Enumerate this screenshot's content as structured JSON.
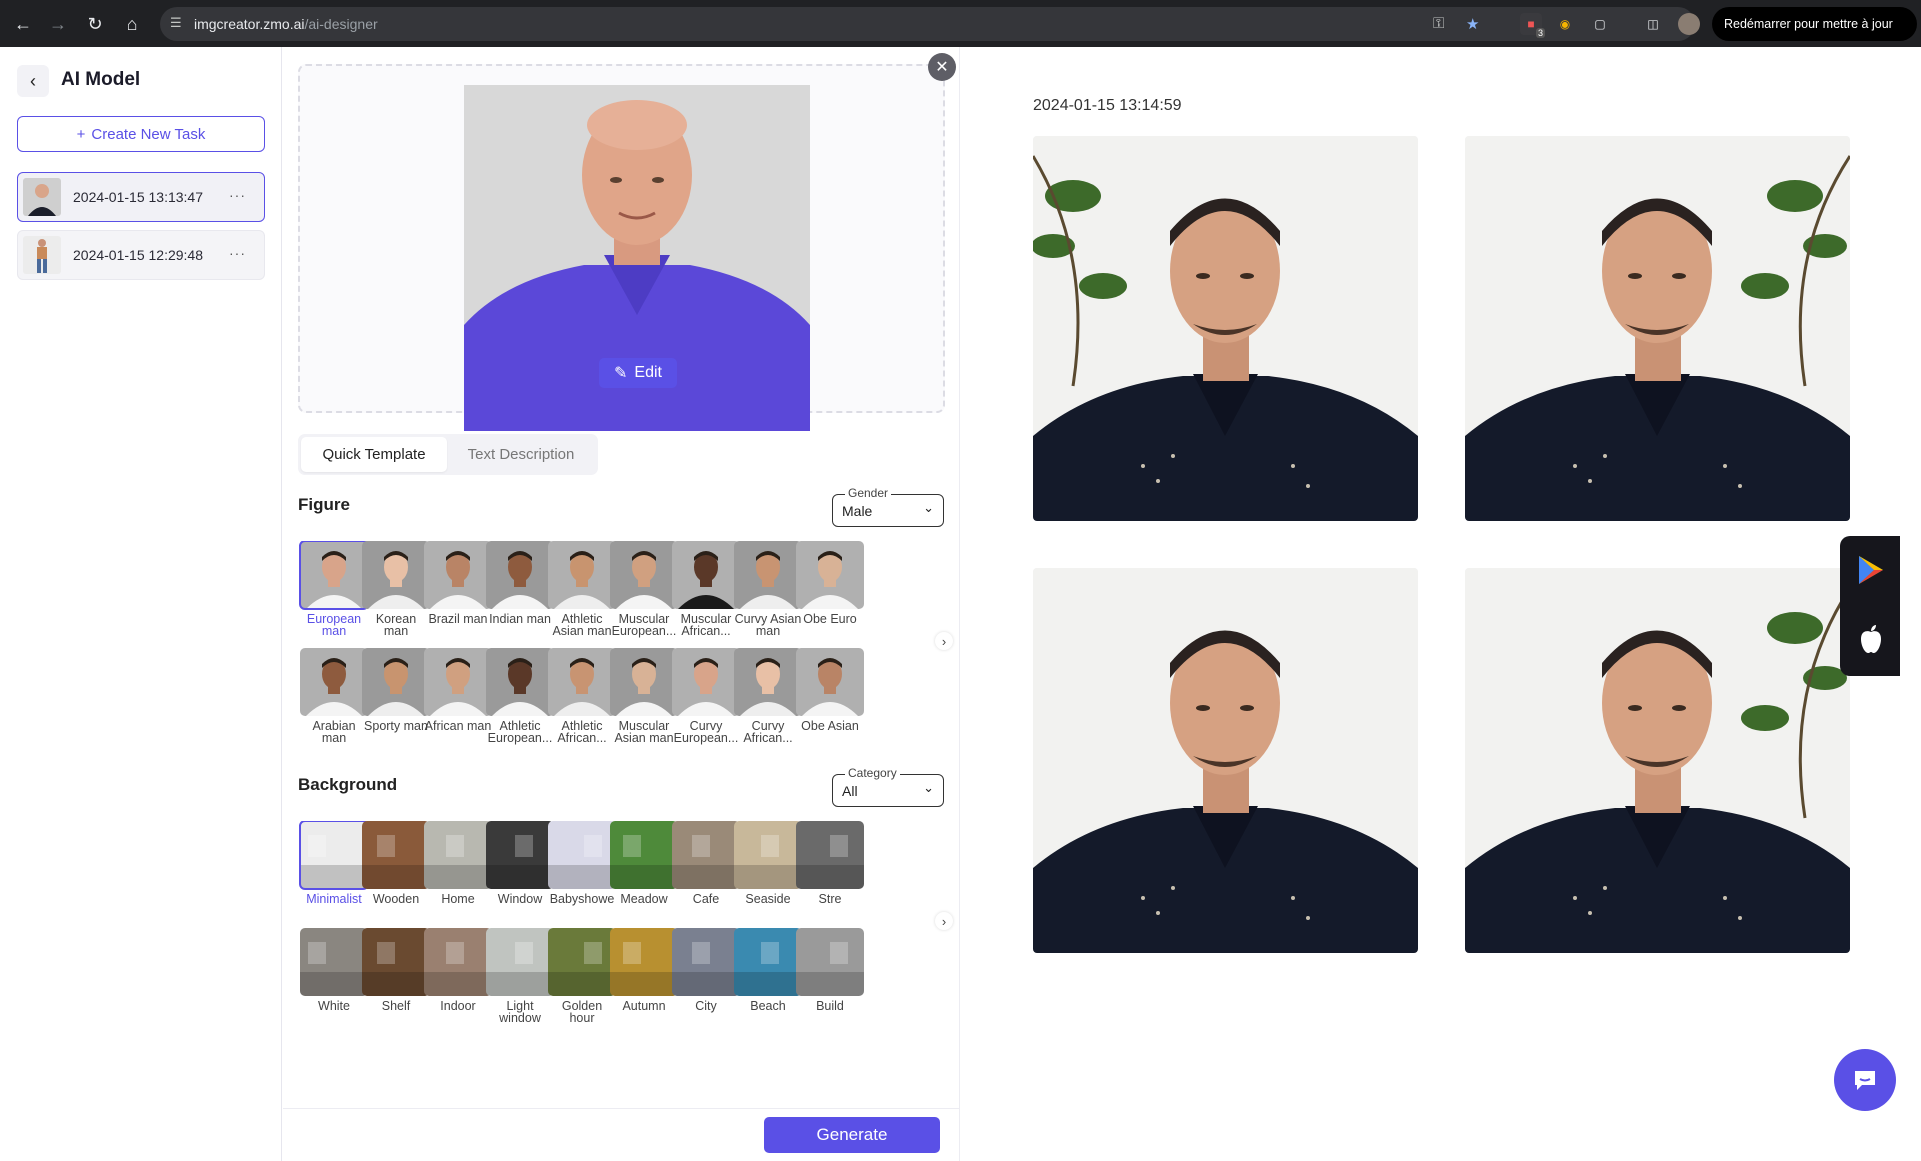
{
  "browser": {
    "url_host": "imgcreator.zmo.ai",
    "url_path": "/ai-designer",
    "update_label": "Redémarrer pour mettre à jour",
    "ext_badge": "3"
  },
  "sidebar": {
    "title": "AI Model",
    "new_task_label": "Create New Task",
    "tasks": [
      {
        "time": "2024-01-15 13:13:47"
      },
      {
        "time": "2024-01-15 12:29:48"
      }
    ]
  },
  "editor": {
    "edit_label": "Edit",
    "tabs": [
      "Quick Template",
      "Text Description"
    ],
    "figure": {
      "title": "Figure",
      "gender_label": "Gender",
      "gender_value": "Male",
      "row1": [
        "European man",
        "Korean man",
        "Brazil man",
        "Indian man",
        "Athletic Asian man",
        "Muscular European...",
        "Muscular African...",
        "Curvy Asian man",
        "Obe Euro"
      ],
      "row2": [
        "Arabian man",
        "Sporty man",
        "African man",
        "Athletic European...",
        "Athletic African...",
        "Muscular Asian man",
        "Curvy European...",
        "Curvy African...",
        "Obe Asian"
      ]
    },
    "background": {
      "title": "Background",
      "category_label": "Category",
      "category_value": "All",
      "row1": [
        "Minimalist",
        "Wooden",
        "Home",
        "Window",
        "Babyshowe",
        "Meadow",
        "Cafe",
        "Seaside",
        "Stre"
      ],
      "row2": [
        "White",
        "Shelf",
        "Indoor",
        "Light window",
        "Golden hour",
        "Autumn",
        "City",
        "Beach",
        "Build"
      ]
    },
    "generate_label": "Generate"
  },
  "results": {
    "date": "2024-01-15 13:14:59"
  },
  "colors": {
    "accent": "#5a50e6",
    "chrome_bg": "#202124"
  }
}
